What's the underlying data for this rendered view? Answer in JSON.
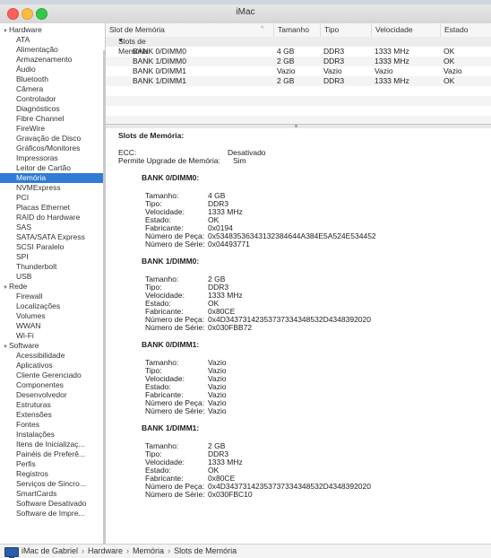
{
  "window": {
    "title": "iMac"
  },
  "sidebar": {
    "groups": [
      {
        "label": "Hardware",
        "items": [
          "ATA",
          "Alimentação",
          "Armazenamento",
          "Áudio",
          "Bluetooth",
          "Câmera",
          "Controlador",
          "Diagnósticos",
          "Fibre Channel",
          "FireWire",
          "Gravação de Disco",
          "Gráficos/Monitores",
          "Impressoras",
          "Leitor de Cartão",
          "Memória",
          "NVMExpress",
          "PCI",
          "Placas Ethernet",
          "RAID do Hardware",
          "SAS",
          "SATA/SATA Express",
          "SCSI Paralelo",
          "SPI",
          "Thunderbolt",
          "USB"
        ]
      },
      {
        "label": "Rede",
        "items": [
          "Firewall",
          "Localizações",
          "Volumes",
          "WWAN",
          "Wi-Fi"
        ]
      },
      {
        "label": "Software",
        "items": [
          "Acessibilidade",
          "Aplicativos",
          "Cliente Gerenciado",
          "Componentes",
          "Desenvolvedor",
          "Estruturas",
          "Extensões",
          "Fontes",
          "Instalações",
          "Itens de Inicializaç...",
          "Painéis de Preferê...",
          "Perfis",
          "Registros",
          "Serviços de Sincro...",
          "SmartCards",
          "Software Desativado",
          "Software de Impre..."
        ]
      }
    ],
    "selected": "Memória"
  },
  "table": {
    "headers": [
      "Slot de Memória",
      "Tamanho",
      "Tipo",
      "Velocidade",
      "Estado"
    ],
    "group_label": "Slots de Memória",
    "rows": [
      [
        "BANK 0/DIMM0",
        "4 GB",
        "DDR3",
        "1333 MHz",
        "OK"
      ],
      [
        "BANK 1/DIMM0",
        "2 GB",
        "DDR3",
        "1333 MHz",
        "OK"
      ],
      [
        "BANK 0/DIMM1",
        "Vazio",
        "Vazio",
        "Vazio",
        "Vazio"
      ],
      [
        "BANK 1/DIMM1",
        "2 GB",
        "DDR3",
        "1333 MHz",
        "OK"
      ]
    ]
  },
  "detail": {
    "title": "Slots de Memória:",
    "ecc_label": "ECC:",
    "ecc_value": "Desativado",
    "upgrade_label": "Permite Upgrade de Memória:",
    "upgrade_value": "Sim",
    "field_labels": [
      "Tamanho:",
      "Tipo:",
      "Velocidade:",
      "Estado:",
      "Fabricante:",
      "Número de Peça:",
      "Número de Série:"
    ],
    "banks": [
      {
        "name": "BANK 0/DIMM0:",
        "values": [
          "4 GB",
          "DDR3",
          "1333 MHz",
          "OK",
          "0x0194",
          "0x53483536343132384644A384E5A524E534452",
          "0x04493771"
        ]
      },
      {
        "name": "BANK 1/DIMM0:",
        "values": [
          "2 GB",
          "DDR3",
          "1333 MHz",
          "OK",
          "0x80CE",
          "0x4D34373142353737334348532D4348392020",
          "0x030FBB72"
        ]
      },
      {
        "name": "BANK 0/DIMM1:",
        "values": [
          "Vazio",
          "Vazio",
          "Vazio",
          "Vazio",
          "Vazio",
          "Vazio",
          "Vazio"
        ]
      },
      {
        "name": "BANK 1/DIMM1:",
        "values": [
          "2 GB",
          "DDR3",
          "1333 MHz",
          "OK",
          "0x80CE",
          "0x4D34373142353737334348532D4348392020",
          "0x030FBC10"
        ]
      }
    ]
  },
  "statusbar": {
    "crumbs": [
      "iMac de Gabriel",
      "Hardware",
      "Memória",
      "Slots de Memória"
    ],
    "separator": "›"
  },
  "colors": {
    "selection": "#2f7bd6",
    "close": "#fc605c",
    "minimize": "#fdbc40",
    "maximize": "#34c84a"
  },
  "icons": [
    "close-icon",
    "minimize-icon",
    "maximize-icon",
    "disclosure-triangle-icon",
    "sort-arrow-icon",
    "imac-icon"
  ]
}
